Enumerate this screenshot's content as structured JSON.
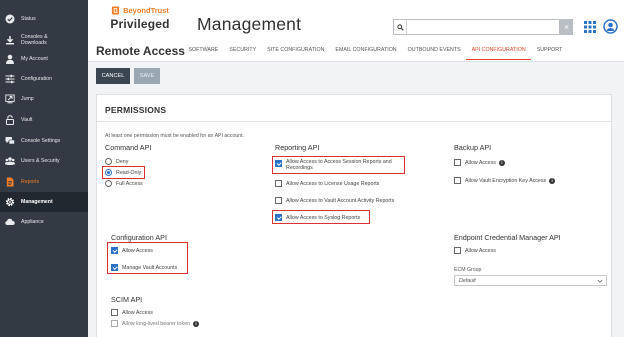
{
  "sidebar": {
    "items": [
      {
        "label": "Status",
        "icon": "check-circle-icon"
      },
      {
        "label": "Consoles &\nDownloads",
        "icon": "download-icon"
      },
      {
        "label": "My Account",
        "icon": "user-icon"
      },
      {
        "label": "Configuration",
        "icon": "sliders-icon"
      },
      {
        "label": "Jump",
        "icon": "jump-icon"
      },
      {
        "label": "Vault",
        "icon": "lock-icon"
      },
      {
        "label": "Console Settings",
        "icon": "chat-icon"
      },
      {
        "label": "Users & Security",
        "icon": "users-icon"
      },
      {
        "label": "Reports",
        "icon": "document-icon"
      },
      {
        "label": "Management",
        "icon": "gear-icon"
      },
      {
        "label": "Appliance",
        "icon": "cloud-icon"
      }
    ]
  },
  "header": {
    "brand_name": "BeyondTrust",
    "brand_line1": "Privileged",
    "brand_line2": "Remote Access",
    "title": "Management",
    "search_value": "",
    "nav_tabs": [
      "SOFTWARE",
      "SECURITY",
      "SITE CONFIGURATION",
      "EMAIL CONFIGURATION",
      "OUTBOUND EVENTS",
      "API CONFIGURATION",
      "SUPPORT"
    ],
    "active_tab": "API CONFIGURATION"
  },
  "toolbar": {
    "cancel_label": "CANCEL",
    "save_label": "SAVE"
  },
  "permissions": {
    "title": "PERMISSIONS",
    "note": "At least one permission must be enabled for an API account.",
    "command_api": {
      "title": "Command API",
      "options": [
        {
          "label": "Deny",
          "selected": false
        },
        {
          "label": "Read-Only",
          "selected": true
        },
        {
          "label": "Full Access",
          "selected": false
        }
      ]
    },
    "reporting_api": {
      "title": "Reporting API",
      "options": [
        {
          "label": "Allow Access to Access Session Reports and\nRecordings",
          "checked": true
        },
        {
          "label": "Allow Access to License Usage Reports",
          "checked": false
        },
        {
          "label": "Allow Access to Vault Account Activity Reports",
          "checked": false
        },
        {
          "label": "Allow Access to Syslog Reports",
          "checked": true
        }
      ]
    },
    "backup_api": {
      "title": "Backup API",
      "options": [
        {
          "label": "Allow Access",
          "checked": false
        },
        {
          "label": "Allow Vault Encryption Key Access",
          "checked": false
        }
      ]
    },
    "configuration_api": {
      "title": "Configuration API",
      "options": [
        {
          "label": "Allow Access",
          "checked": true
        },
        {
          "label": "Manage Vault Accounts",
          "checked": true
        }
      ]
    },
    "ecm_api": {
      "title": "Endpoint Credential Manager API",
      "options": [
        {
          "label": "Allow Access",
          "checked": false
        }
      ],
      "group_label": "ECM Group",
      "group_value": "Default"
    },
    "scim_api": {
      "title": "SCIM API",
      "options": [
        {
          "label": "Allow Access",
          "checked": false
        },
        {
          "label": "Allow long-lived bearer token",
          "checked": false
        }
      ]
    }
  },
  "colors": {
    "sidebar_bg": "#333a44",
    "accent": "#ef7d28",
    "active_tab": "#e1452e",
    "checkbox": "#2b72c7",
    "highlight": "#d93232"
  }
}
